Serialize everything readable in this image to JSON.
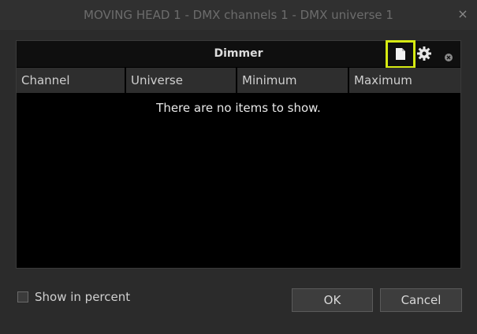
{
  "window": {
    "title": "MOVING HEAD  1 - DMX channels 1 - DMX universe 1",
    "close_glyph": "×"
  },
  "panel": {
    "title": "Dimmer",
    "icons": [
      "new-document-icon",
      "gear-icon",
      "close-icon"
    ],
    "highlight_color": "#d6ea12",
    "columns": [
      "Channel",
      "Universe",
      "Minimum",
      "Maximum"
    ],
    "empty_message": "There are no items to show."
  },
  "footer": {
    "checkbox_label": "Show in percent",
    "checkbox_checked": false,
    "ok_label": "OK",
    "cancel_label": "Cancel"
  }
}
